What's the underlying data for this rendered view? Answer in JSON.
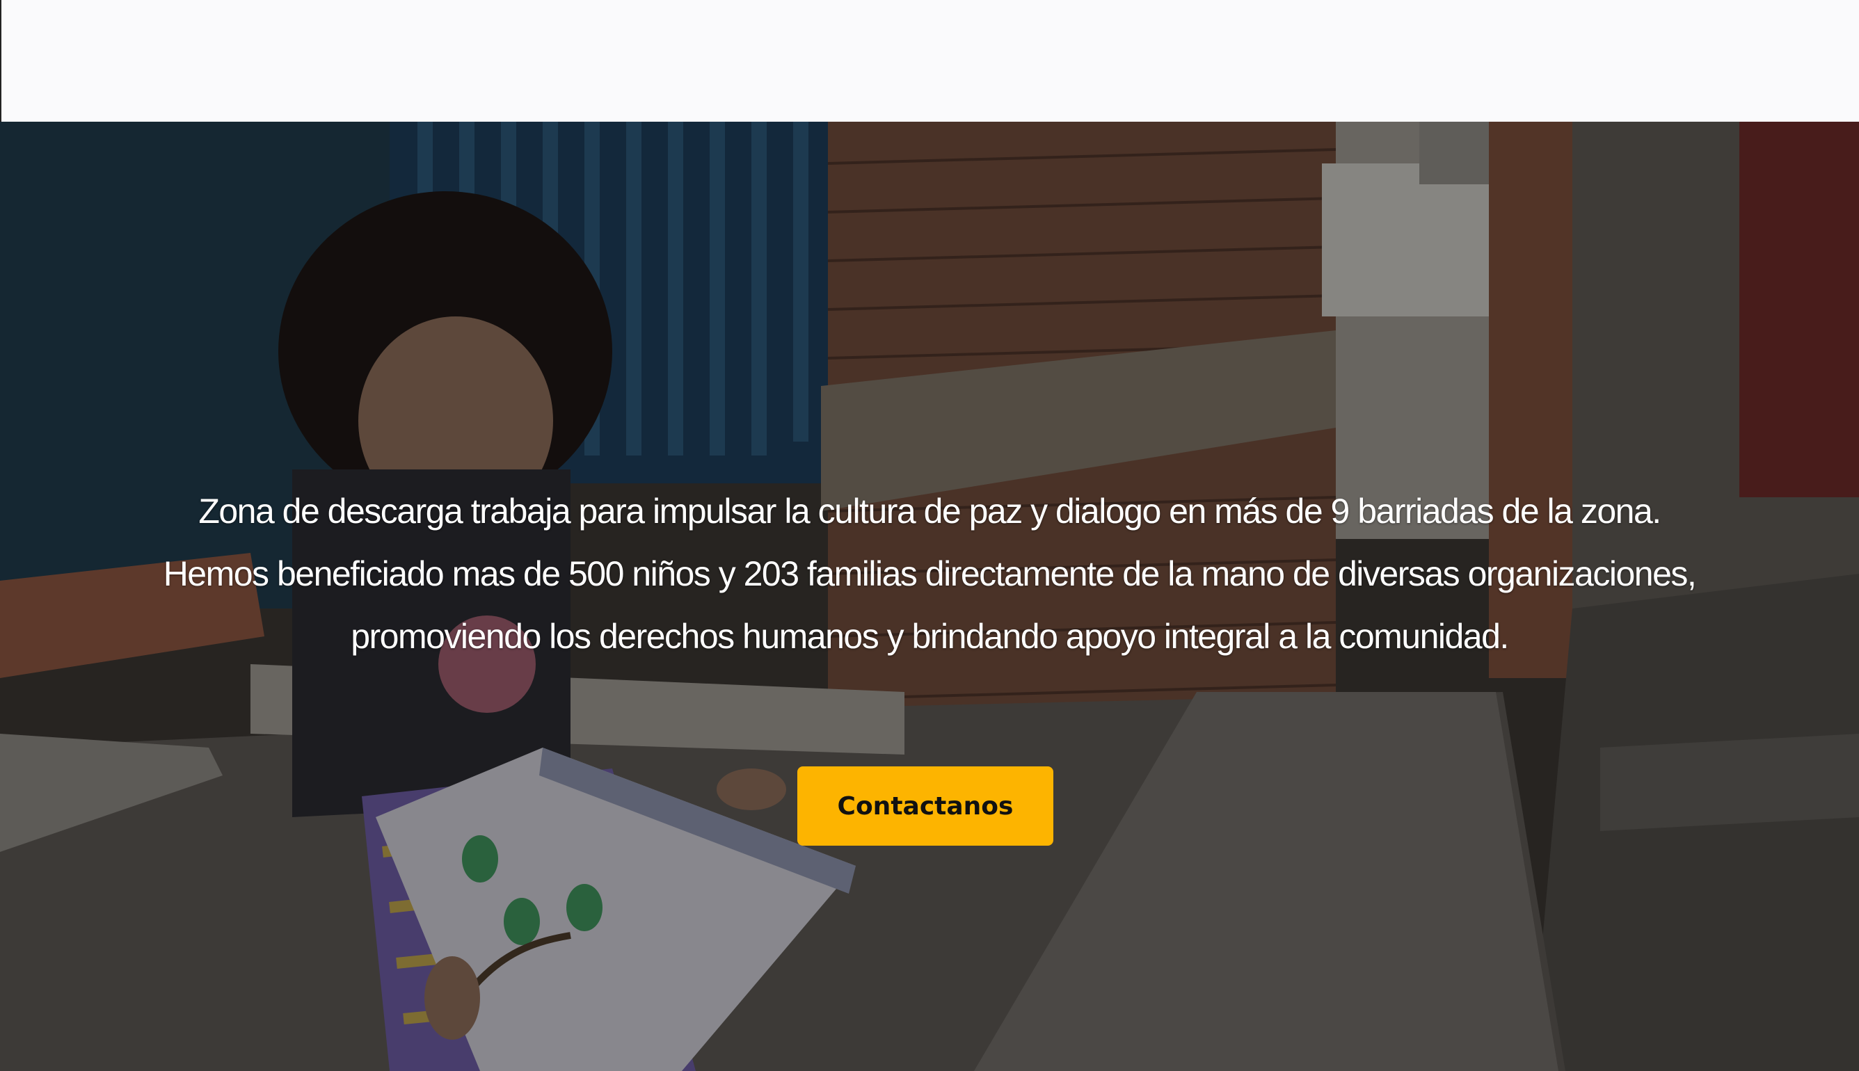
{
  "hero": {
    "lines": [
      "Zona de descarga trabaja para impulsar la cultura de paz y dialogo en más de 9 barriadas de la zona.",
      "Hemos beneficiado mas de 500 niños y 203 familias directamente de la mano de diversas organizaciones,",
      "promoviendo los derechos humanos y brindando apoyo integral a la comunidad."
    ],
    "cta_label": "Contactanos"
  },
  "colors": {
    "cta_background": "#fdb400",
    "header_background": "#fafafc"
  },
  "image": {
    "subject": "girl-reading-book-in-alley"
  }
}
